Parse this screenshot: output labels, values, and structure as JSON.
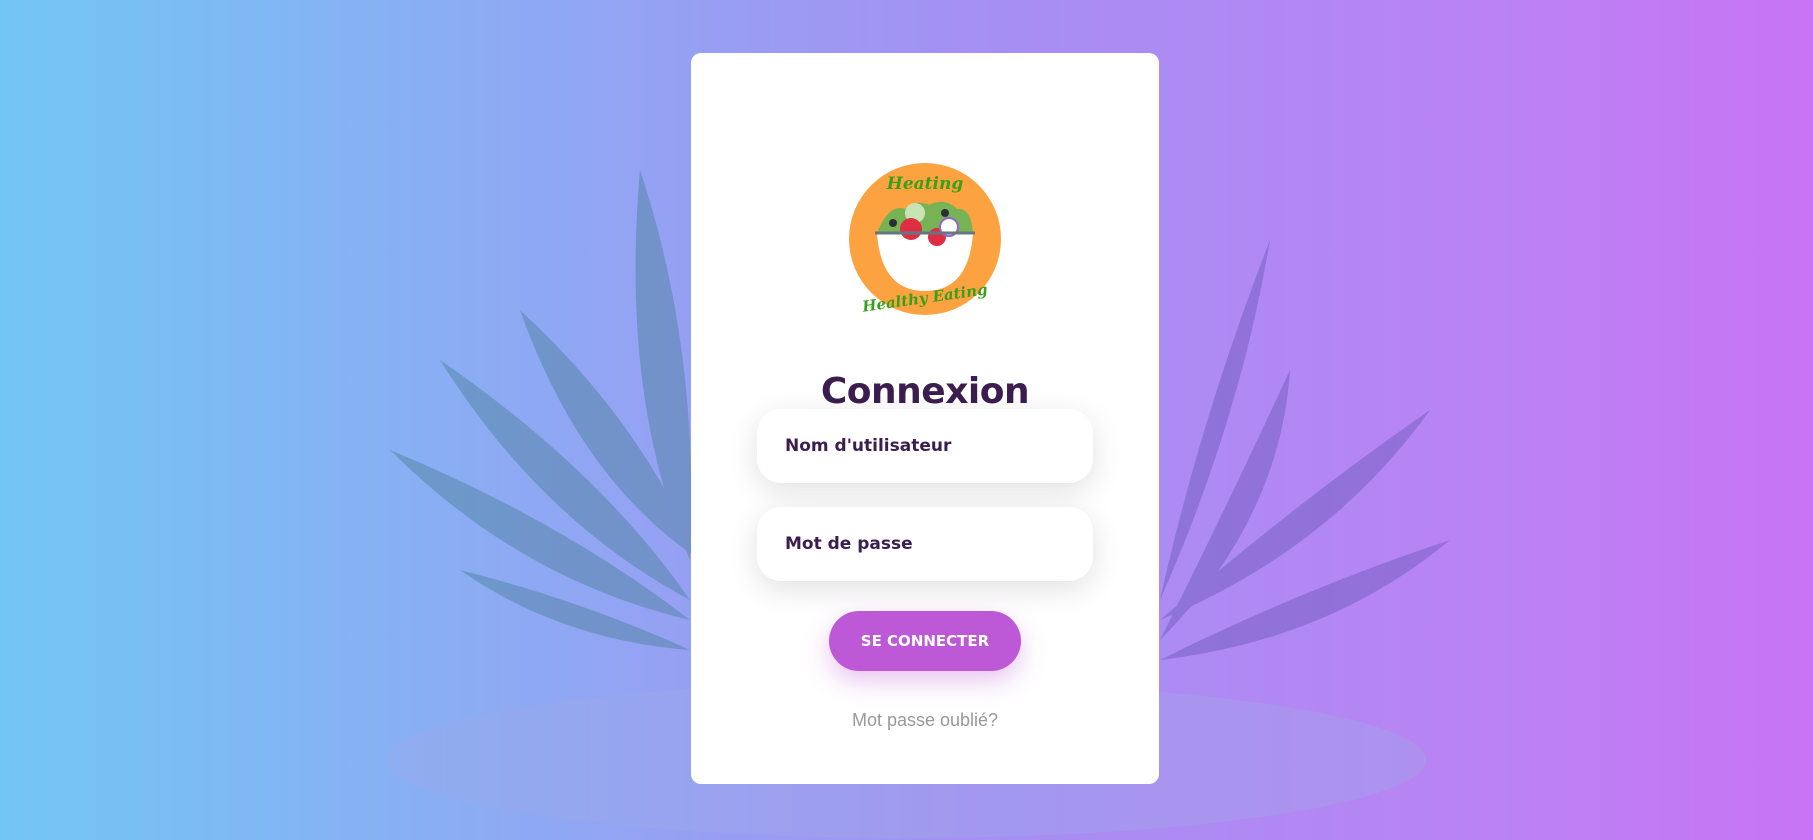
{
  "logo": {
    "top_text": "Heating",
    "bottom_text": "Healthy Eating"
  },
  "form": {
    "title": "Connexion",
    "username_placeholder": "Nom d'utilisateur",
    "password_placeholder": "Mot de passe",
    "submit_label": "SE CONNECTER",
    "forgot_link": "Mot passe oublié?"
  },
  "colors": {
    "accent": "#bd58d6",
    "title": "#3c1d4f",
    "logo_bg": "#fca240"
  }
}
